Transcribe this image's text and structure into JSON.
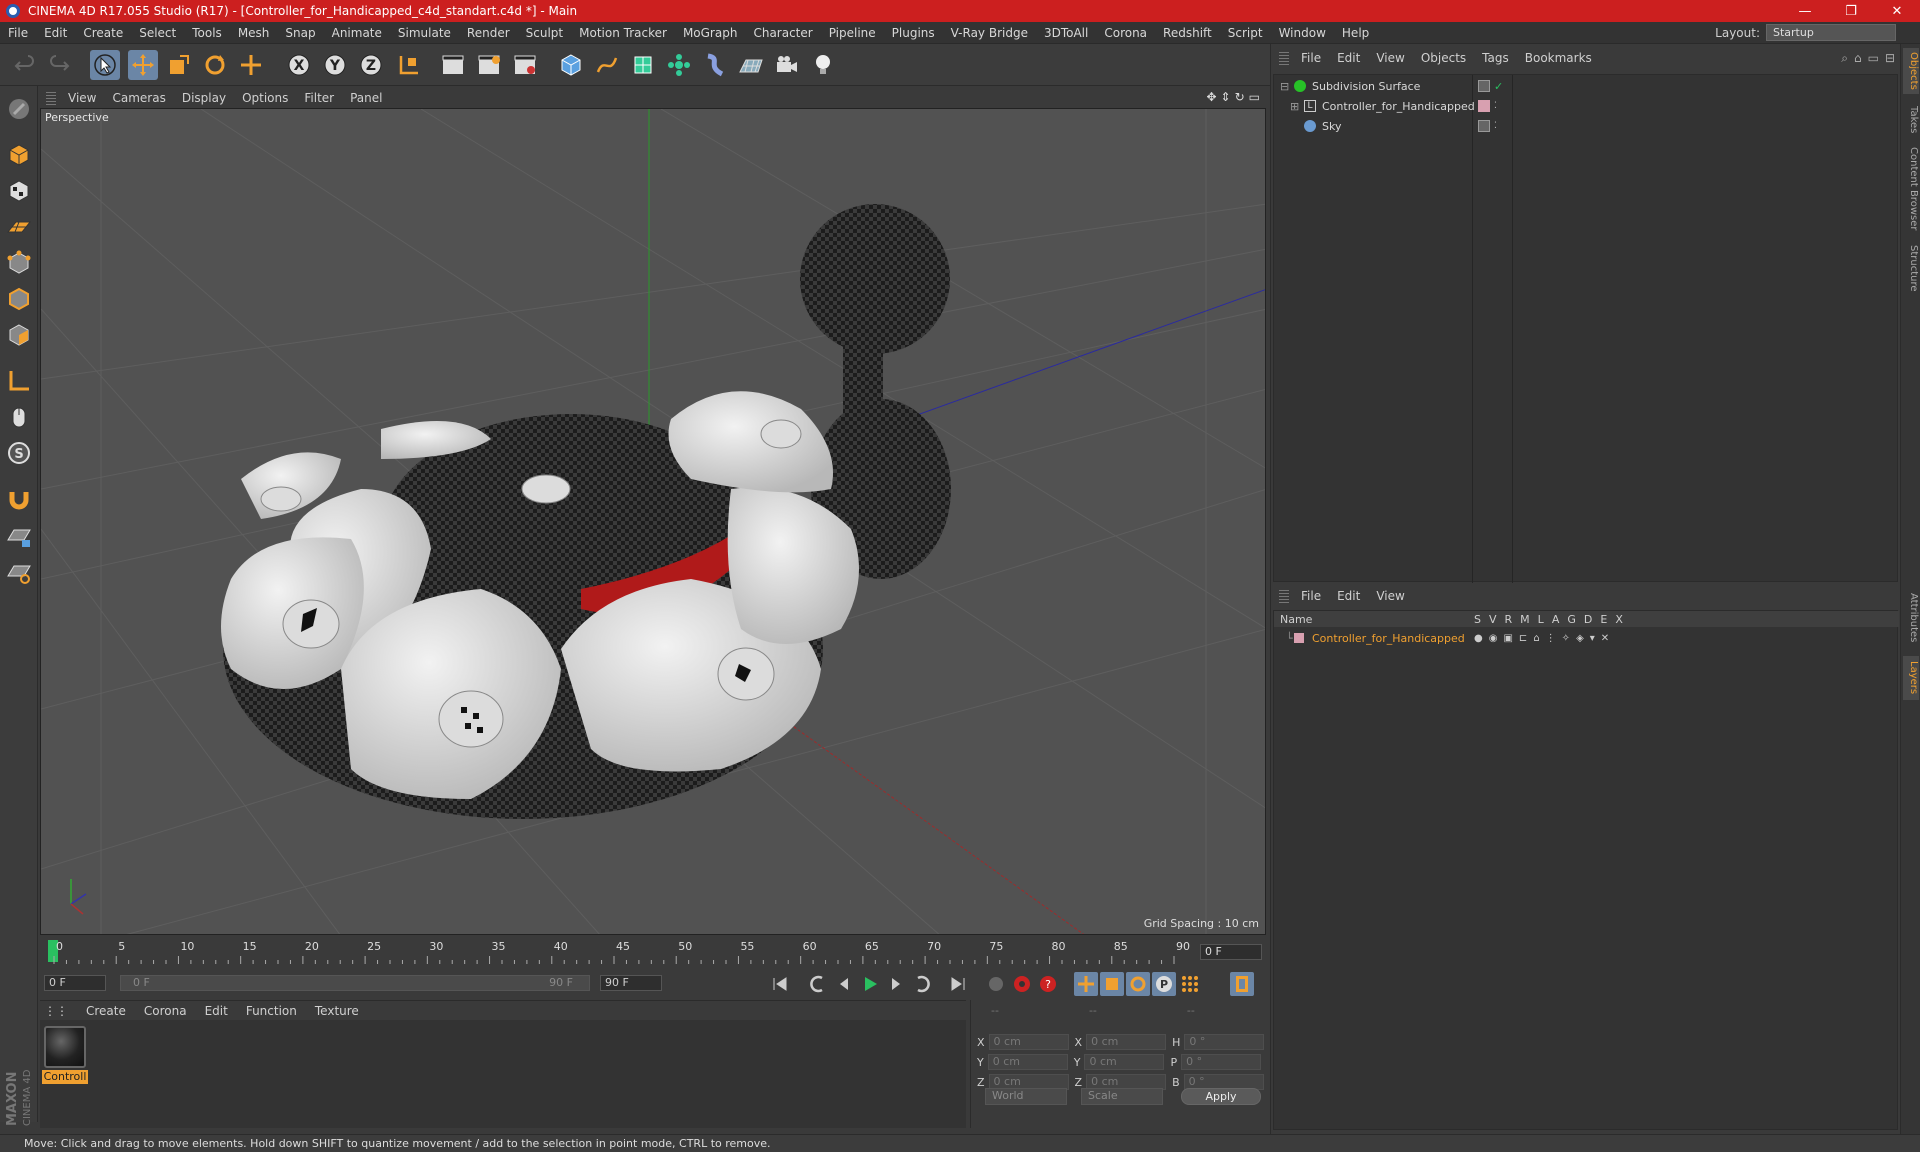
{
  "window": {
    "title": "CINEMA 4D R17.055 Studio (R17) - [Controller_for_Handicapped_c4d_standart.c4d *] - Main",
    "minimize": "—",
    "maximize": "❐",
    "close": "✕"
  },
  "menubar": {
    "items": [
      "File",
      "Edit",
      "Create",
      "Select",
      "Tools",
      "Mesh",
      "Snap",
      "Animate",
      "Simulate",
      "Render",
      "Sculpt",
      "Motion Tracker",
      "MoGraph",
      "Character",
      "Pipeline",
      "Plugins",
      "V-Ray Bridge",
      "3DToAll",
      "Corona",
      "Redshift",
      "Script",
      "Window",
      "Help"
    ],
    "layout_label": "Layout:",
    "layout_value": "Startup"
  },
  "viewport": {
    "menu": [
      "View",
      "Cameras",
      "Display",
      "Options",
      "Filter",
      "Panel"
    ],
    "label": "Perspective",
    "grid_spacing": "Grid Spacing : 10 cm"
  },
  "timeline": {
    "ticks": [
      "0",
      "5",
      "10",
      "15",
      "20",
      "25",
      "30",
      "35",
      "40",
      "45",
      "50",
      "55",
      "60",
      "65",
      "70",
      "75",
      "80",
      "85",
      "90"
    ],
    "current_frame": "0 F"
  },
  "playbar": {
    "start": "0 F",
    "range_start": "0 F",
    "range_end": "90 F",
    "end": "90 F"
  },
  "material": {
    "menu": [
      "Create",
      "Corona",
      "Edit",
      "Function",
      "Texture"
    ],
    "items": [
      {
        "name": "Controll"
      }
    ]
  },
  "coords": {
    "header": [
      "--",
      "--",
      "--"
    ],
    "rows": [
      {
        "a": "X",
        "av": "0 cm",
        "b": "X",
        "bv": "0 cm",
        "c": "H",
        "cv": "0 °"
      },
      {
        "a": "Y",
        "av": "0 cm",
        "b": "Y",
        "bv": "0 cm",
        "c": "P",
        "cv": "0 °"
      },
      {
        "a": "Z",
        "av": "0 cm",
        "b": "Z",
        "bv": "0 cm",
        "c": "B",
        "cv": "0 °"
      }
    ],
    "world": "World",
    "scale": "Scale",
    "apply": "Apply"
  },
  "status": "Move: Click and drag to move elements. Hold down SHIFT to quantize movement / add to the selection in point mode, CTRL to remove.",
  "objects_panel": {
    "menu": [
      "File",
      "Edit",
      "View",
      "Objects",
      "Tags",
      "Bookmarks"
    ],
    "rows": [
      {
        "name": "Subdivision Surface",
        "color": "#27c227"
      },
      {
        "name": "Controller_for_Handicapped",
        "color": "#c0c0c0"
      },
      {
        "name": "Sky",
        "color": "#6a9ad0"
      }
    ]
  },
  "layers_panel": {
    "menu": [
      "File",
      "Edit",
      "View"
    ],
    "header_name": "Name",
    "header_cols": [
      "S",
      "V",
      "R",
      "M",
      "L",
      "A",
      "G",
      "D",
      "E",
      "X"
    ],
    "rows": [
      {
        "name": "Controller_for_Handicapped",
        "color": "#f0a030"
      }
    ]
  },
  "side_tabs": [
    "Objects",
    "Takes",
    "Content Browser",
    "Structure",
    "Attributes",
    "Layers"
  ],
  "maxon_label": "MAXON CINEMA 4D"
}
